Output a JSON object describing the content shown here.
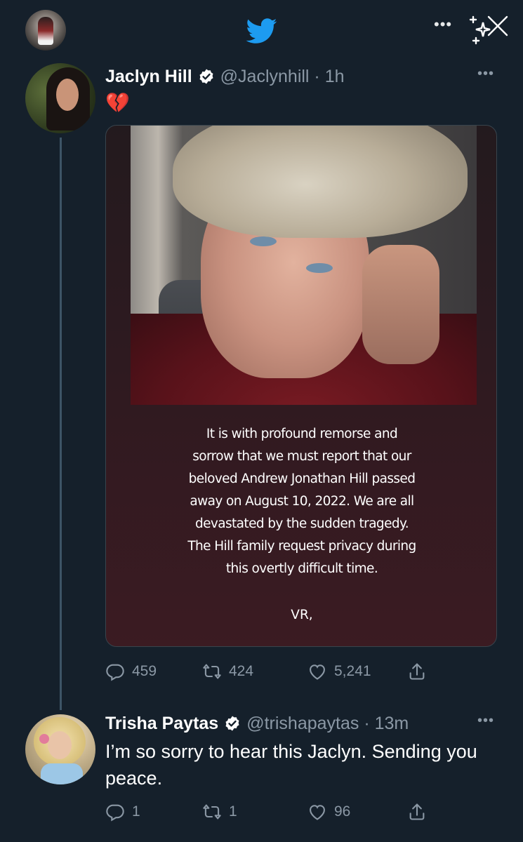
{
  "header": {
    "more_label": "•••",
    "icons": [
      "user-avatar-icon",
      "twitter-bird-icon",
      "more-icon",
      "sparkle-close-icon"
    ]
  },
  "tweet": {
    "author_name": "Jaclyn Hill",
    "handle_time": "@Jaclynhill · 1h",
    "text": "💔",
    "more_label": "•••",
    "media_statement_lines": [
      "It is with profound remorse and",
      "sorrow that we must report that our",
      "beloved Andrew Jonathan Hill passed",
      "away on August 10, 2022. We are all",
      "devastated by the sudden tragedy.",
      "The Hill family request privacy during",
      "this overtly difficult time."
    ],
    "media_signoff": "VR,",
    "stats": {
      "replies": "459",
      "retweets": "424",
      "likes": "5,241"
    }
  },
  "reply": {
    "author_name": "Trisha Paytas",
    "handle_time": "@trishapaytas · 13m",
    "more_label": "•••",
    "text": "I’m so sorry to hear this Jaclyn. Sending you peace.",
    "stats": {
      "replies": "1",
      "retweets": "1",
      "likes": "96"
    }
  },
  "colors": {
    "background": "#15202b",
    "secondary_text": "#8b98a5",
    "twitter_blue": "#1d9bf0",
    "verified_badge": "#ffffff"
  }
}
